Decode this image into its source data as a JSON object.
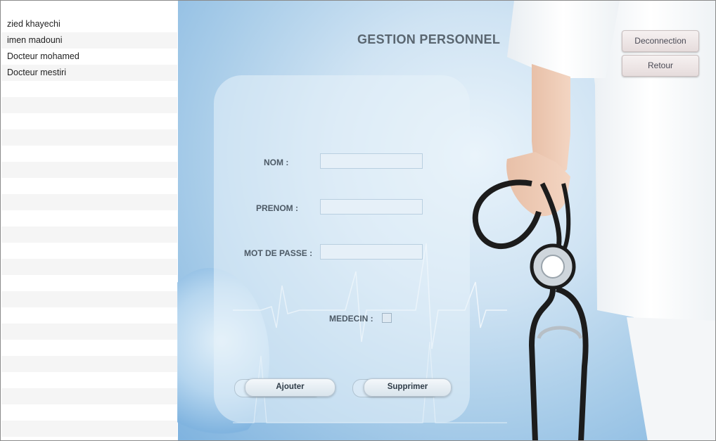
{
  "users": [
    "zied khayechi",
    "imen madouni",
    "Docteur mohamed",
    "Docteur mestiri"
  ],
  "empty_rows": 22,
  "header": {
    "title": "GESTION PERSONNEL"
  },
  "top_buttons": {
    "deconnection": "Deconnection",
    "retour": "Retour"
  },
  "form": {
    "nom_label": "NOM :",
    "prenom_label": "PRENOM :",
    "password_label": "MOT DE PASSE :",
    "medecin_label": "MEDECIN :",
    "nom_value": "",
    "prenom_value": "",
    "password_value": "",
    "medecin_checked": false
  },
  "actions": {
    "add": "Ajouter",
    "delete": "Supprimer"
  }
}
